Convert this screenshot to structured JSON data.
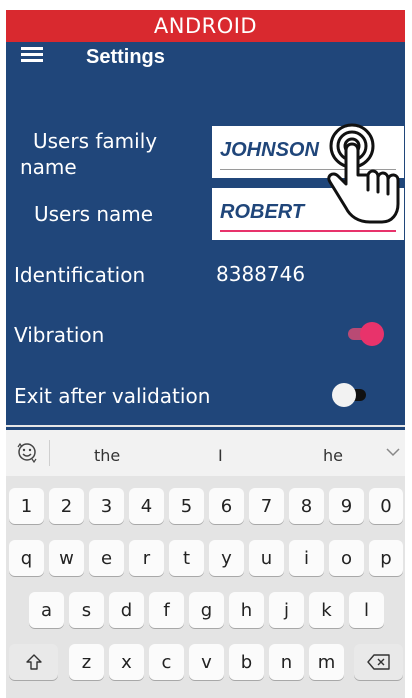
{
  "banner": {
    "label": "ANDROID"
  },
  "toolbar": {
    "menu_icon": "hamburger-menu-icon",
    "title": "Settings"
  },
  "form": {
    "family_name": {
      "label_line1": "Users family",
      "label_line2": "name",
      "value": "JOHNSON"
    },
    "user_name": {
      "label": "Users name",
      "value": "ROBERT"
    },
    "identification": {
      "label": "Identification",
      "value": "8388746"
    },
    "vibration": {
      "label": "Vibration",
      "on": true
    },
    "exit_after_validation": {
      "label": "Exit after validation",
      "on": false
    }
  },
  "keyboard": {
    "suggestions": [
      "the",
      "I",
      "he"
    ],
    "number_row": [
      "1",
      "2",
      "3",
      "4",
      "5",
      "6",
      "7",
      "8",
      "9",
      "0"
    ],
    "row1": [
      "q",
      "w",
      "e",
      "r",
      "t",
      "y",
      "u",
      "i",
      "o",
      "p"
    ],
    "row2": [
      "a",
      "s",
      "d",
      "f",
      "g",
      "h",
      "j",
      "k",
      "l"
    ],
    "row3": [
      "z",
      "x",
      "c",
      "v",
      "b",
      "n",
      "m"
    ],
    "shift_icon": "shift-icon",
    "backspace_icon": "backspace-icon"
  },
  "colors": {
    "banner": "#d9292f",
    "background": "#20467a",
    "accent": "#e8336b"
  }
}
